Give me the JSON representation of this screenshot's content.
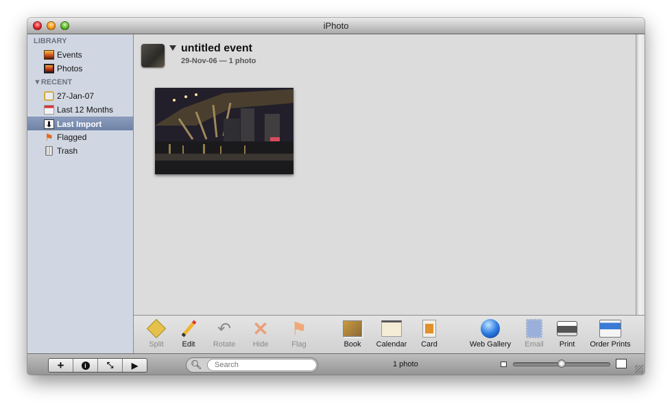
{
  "window": {
    "title": "iPhoto"
  },
  "sidebar": {
    "library_header": "LIBRARY",
    "library_items": [
      {
        "label": "Events",
        "icon": "events-icon"
      },
      {
        "label": "Photos",
        "icon": "photos-icon"
      }
    ],
    "recent_header": "RECENT",
    "recent_items": [
      {
        "label": "27-Jan-07",
        "icon": "event-album-icon"
      },
      {
        "label": "Last 12 Months",
        "icon": "calendar-icon"
      },
      {
        "label": "Last Import",
        "icon": "import-icon",
        "selected": true
      },
      {
        "label": "Flagged",
        "icon": "flag-icon"
      },
      {
        "label": "Trash",
        "icon": "trash-icon"
      }
    ]
  },
  "event": {
    "title": "untitled event",
    "subtitle": "29-Nov-06 — 1 photo"
  },
  "toolbar": {
    "items": [
      {
        "label": "Split",
        "enabled": false
      },
      {
        "label": "Edit",
        "enabled": true
      },
      {
        "label": "Rotate",
        "enabled": false
      },
      {
        "label": "Hide",
        "enabled": false
      },
      {
        "label": "Flag",
        "enabled": false
      },
      {
        "label": "Book",
        "enabled": true
      },
      {
        "label": "Calendar",
        "enabled": true
      },
      {
        "label": "Card",
        "enabled": true
      },
      {
        "label": "Web Gallery",
        "enabled": true
      },
      {
        "label": "Email",
        "enabled": false
      },
      {
        "label": "Print",
        "enabled": true
      },
      {
        "label": "Order Prints",
        "enabled": true
      }
    ]
  },
  "bottom": {
    "search_placeholder": "Search",
    "photo_count": "1 photo",
    "zoom_slider_value": 0.5,
    "buttons": {
      "add": "+",
      "info": "i",
      "fullscreen": "⤡",
      "play": "▶"
    }
  }
}
